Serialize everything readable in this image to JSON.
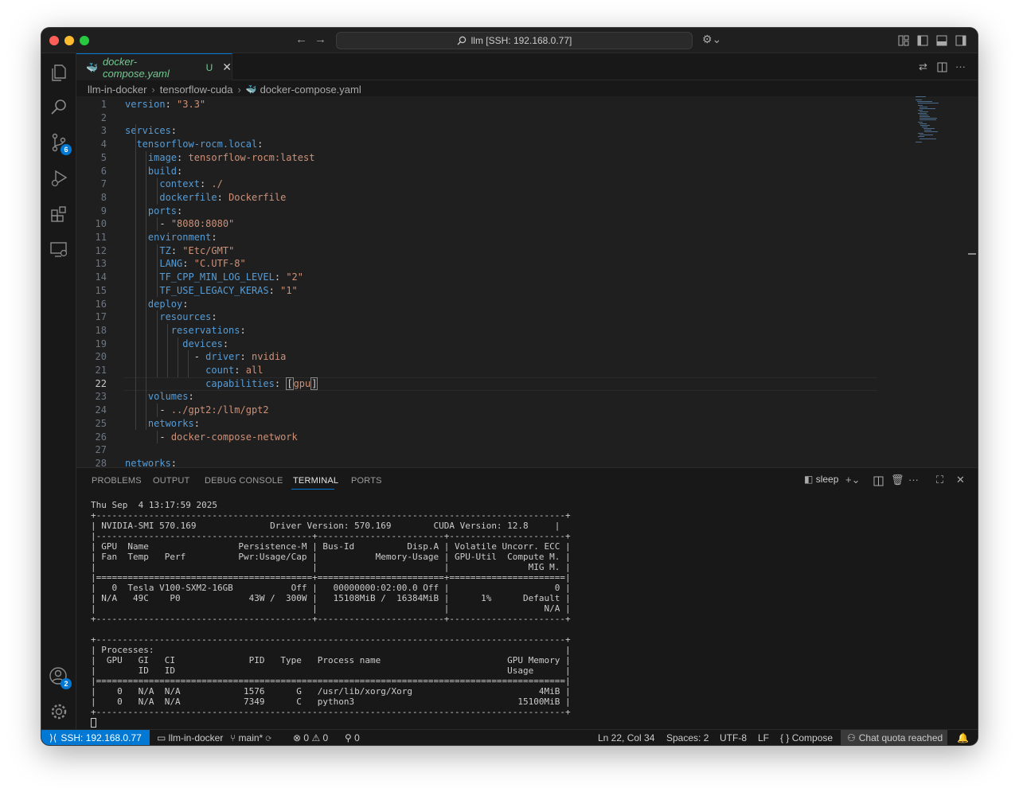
{
  "titlebar": {
    "search_text": "llm [SSH: 192.168.0.77]"
  },
  "activity": {
    "scm_badge": "6",
    "accounts_badge": "2"
  },
  "tab": {
    "filename": "docker-compose.yaml",
    "modified": "U"
  },
  "breadcrumb": {
    "parts": [
      "llm-in-docker",
      "tensorflow-cuda",
      "docker-compose.yaml"
    ]
  },
  "editor": {
    "active_line": 22,
    "lines": [
      {
        "n": "1",
        "text": "version: \"3.3\""
      },
      {
        "n": "2",
        "text": ""
      },
      {
        "n": "3",
        "text": "services:"
      },
      {
        "n": "4",
        "text": "  tensorflow-rocm.local:"
      },
      {
        "n": "5",
        "text": "    image: tensorflow-rocm:latest"
      },
      {
        "n": "6",
        "text": "    build:"
      },
      {
        "n": "7",
        "text": "      context: ./"
      },
      {
        "n": "8",
        "text": "      dockerfile: Dockerfile"
      },
      {
        "n": "9",
        "text": "    ports:"
      },
      {
        "n": "10",
        "text": "      - \"8080:8080\""
      },
      {
        "n": "11",
        "text": "    environment:"
      },
      {
        "n": "12",
        "text": "      TZ: \"Etc/GMT\""
      },
      {
        "n": "13",
        "text": "      LANG: \"C.UTF-8\""
      },
      {
        "n": "14",
        "text": "      TF_CPP_MIN_LOG_LEVEL: \"2\""
      },
      {
        "n": "15",
        "text": "      TF_USE_LEGACY_KERAS: \"1\""
      },
      {
        "n": "16",
        "text": "    deploy:"
      },
      {
        "n": "17",
        "text": "      resources:"
      },
      {
        "n": "18",
        "text": "        reservations:"
      },
      {
        "n": "19",
        "text": "          devices:"
      },
      {
        "n": "20",
        "text": "            - driver: nvidia"
      },
      {
        "n": "21",
        "text": "              count: all"
      },
      {
        "n": "22",
        "text": "              capabilities: [gpu]"
      },
      {
        "n": "23",
        "text": "    volumes:"
      },
      {
        "n": "24",
        "text": "      - ../gpt2:/llm/gpt2"
      },
      {
        "n": "25",
        "text": "    networks:"
      },
      {
        "n": "26",
        "text": "      - docker-compose-network"
      },
      {
        "n": "27",
        "text": ""
      },
      {
        "n": "28",
        "text": "networks:"
      }
    ]
  },
  "panel": {
    "tabs": [
      "PROBLEMS",
      "OUTPUT",
      "DEBUG CONSOLE",
      "TERMINAL",
      "PORTS"
    ],
    "active_tab": "TERMINAL",
    "terminal_name": "sleep",
    "terminal_lines": [
      "Thu Sep  4 13:17:59 2025",
      "+-----------------------------------------------------------------------------------------+",
      "| NVIDIA-SMI 570.169              Driver Version: 570.169        CUDA Version: 12.8     |",
      "|-----------------------------------------+------------------------+----------------------+",
      "| GPU  Name                 Persistence-M | Bus-Id          Disp.A | Volatile Uncorr. ECC |",
      "| Fan  Temp   Perf          Pwr:Usage/Cap |           Memory-Usage | GPU-Util  Compute M. |",
      "|                                         |                        |               MIG M. |",
      "|=========================================+========================+======================|",
      "|   0  Tesla V100-SXM2-16GB           Off |   00000000:02:00.0 Off |                    0 |",
      "| N/A   49C    P0             43W /  300W |   15108MiB /  16384MiB |      1%      Default |",
      "|                                         |                        |                  N/A |",
      "+-----------------------------------------+------------------------+----------------------+",
      "",
      "+-----------------------------------------------------------------------------------------+",
      "| Processes:                                                                              |",
      "|  GPU   GI   CI              PID   Type   Process name                        GPU Memory |",
      "|        ID   ID                                                               Usage      |",
      "|=========================================================================================|",
      "|    0   N/A  N/A            1576      G   /usr/lib/xorg/Xorg                        4MiB |",
      "|    0   N/A  N/A            7349      C   python3                               15100MiB |",
      "+-----------------------------------------------------------------------------------------+"
    ]
  },
  "statusbar": {
    "remote": "SSH: 192.168.0.77",
    "folder": "llm-in-docker",
    "branch": "main*",
    "errors": "0",
    "warnings": "0",
    "ports": "0",
    "cursor_pos": "Ln 22, Col 34",
    "spaces": "Spaces: 2",
    "encoding": "UTF-8",
    "eol": "LF",
    "language": "Compose",
    "chat": "Chat quota reached"
  },
  "colors": {
    "accent": "#0078d4",
    "key": "#569cd6",
    "string": "#ce9178",
    "modified": "#73c991"
  }
}
